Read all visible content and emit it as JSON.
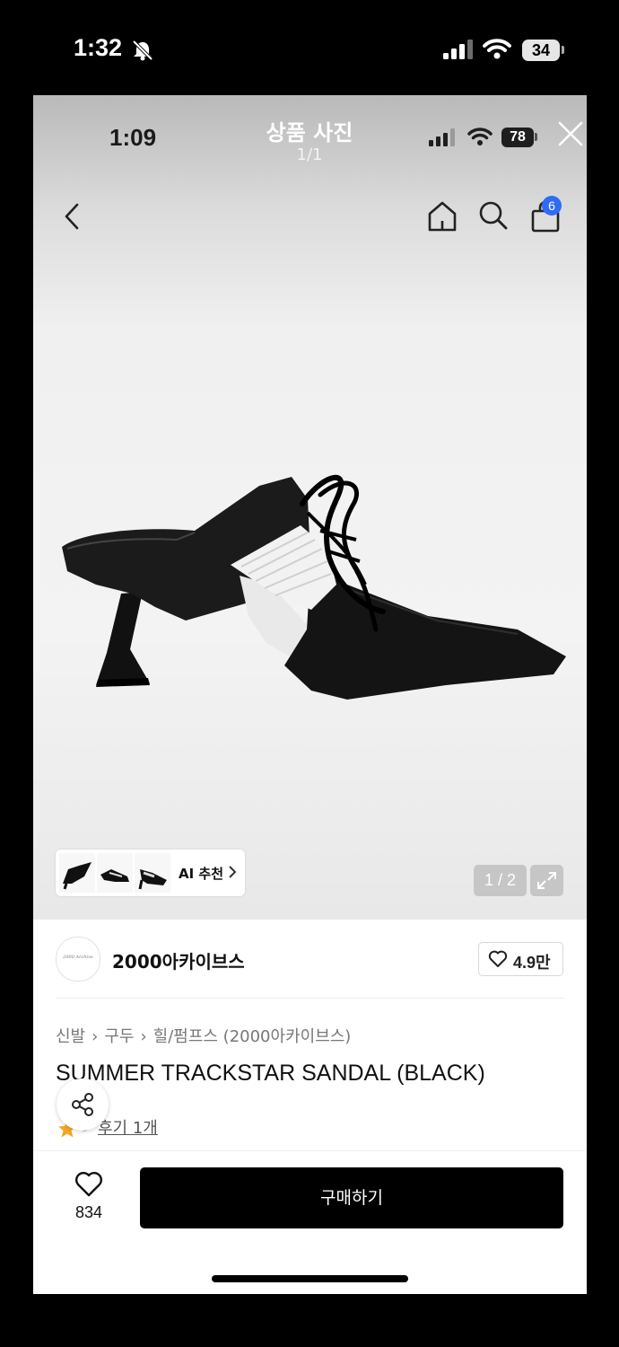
{
  "outer_status_bar": {
    "time": "1:32",
    "battery": "34"
  },
  "inner_status_bar": {
    "time": "1:09",
    "battery": "78"
  },
  "viewer": {
    "title": "상품 사진",
    "counter": "1/1"
  },
  "header": {
    "cart_badge": "6"
  },
  "gallery": {
    "ai_label": "AI 추천",
    "page_indicator": "1 / 2"
  },
  "brand": {
    "logo_text": "2000 Archive",
    "name": "2000아카이브스",
    "like_count": "4.9만"
  },
  "breadcrumb": [
    "신발",
    "구두",
    "힐/펌프스 (2000아카이브스)"
  ],
  "product": {
    "title": "SUMMER TRACKSTAR SANDAL (BLACK)",
    "rating": "5",
    "review_link": "후기 1개"
  },
  "bottom_bar": {
    "wish_count": "834",
    "buy_label": "구매하기"
  },
  "colors": {
    "cart_badge": "#2f6cf5",
    "rating_star": "#f5a524",
    "buy_button": "#000000"
  }
}
